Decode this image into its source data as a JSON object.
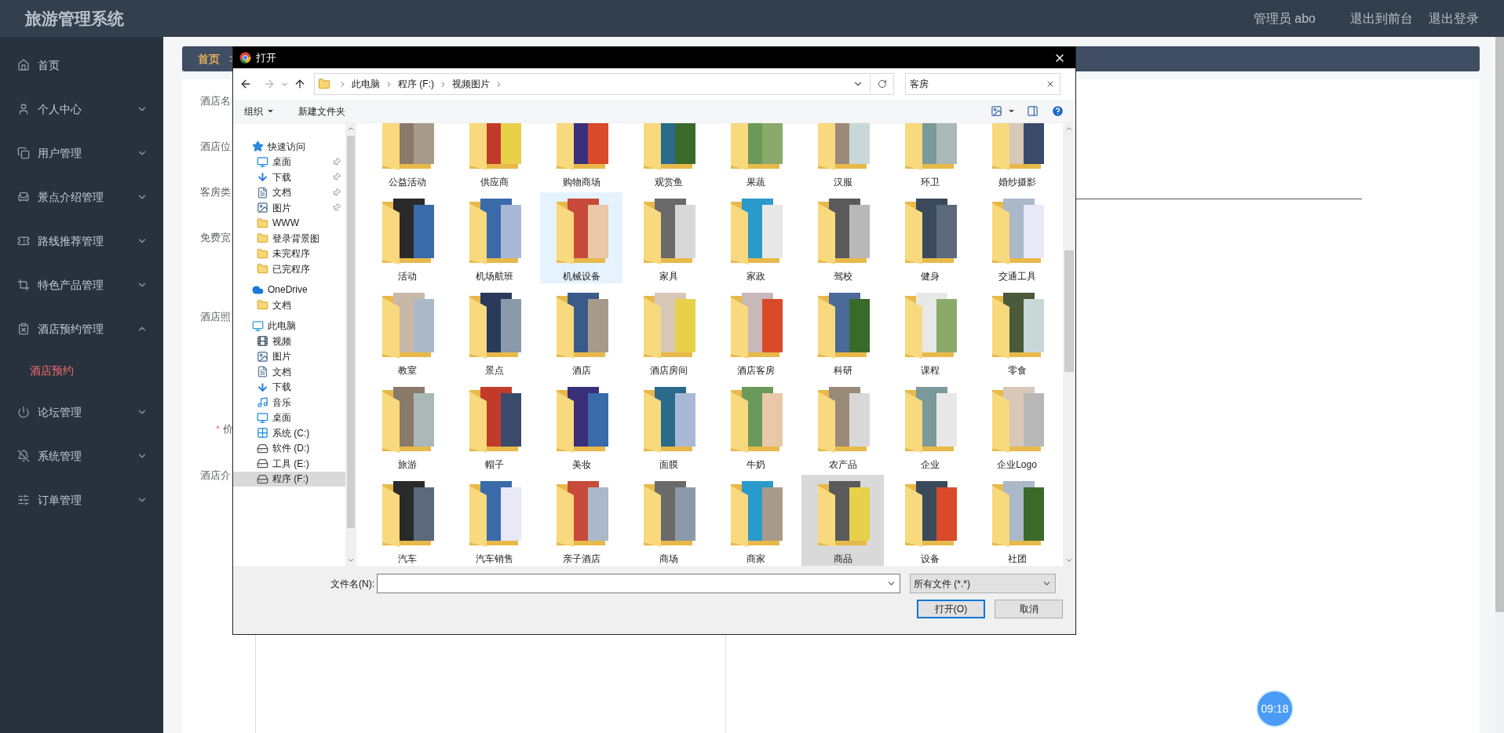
{
  "header": {
    "title": "旅游管理系统",
    "user": "管理员 abo",
    "links": [
      "退出到前台",
      "退出登录"
    ]
  },
  "sidebar": {
    "items": [
      {
        "label": "首页",
        "expandable": false
      },
      {
        "label": "个人中心",
        "expandable": true,
        "expanded": false
      },
      {
        "label": "用户管理",
        "expandable": true,
        "expanded": false
      },
      {
        "label": "景点介绍管理",
        "expandable": true,
        "expanded": false
      },
      {
        "label": "路线推荐管理",
        "expandable": true,
        "expanded": false
      },
      {
        "label": "特色产品管理",
        "expandable": true,
        "expanded": false
      },
      {
        "label": "酒店预约管理",
        "expandable": true,
        "expanded": true,
        "children": [
          {
            "label": "酒店预约",
            "selected": true
          }
        ]
      },
      {
        "label": "论坛管理",
        "expandable": true,
        "expanded": false
      },
      {
        "label": "系统管理",
        "expandable": true,
        "expanded": false
      },
      {
        "label": "订单管理",
        "expandable": true,
        "expanded": false
      }
    ]
  },
  "breadcrumb": {
    "items": [
      "首页"
    ],
    "separator": ">"
  },
  "form": {
    "required_mark": "*",
    "labels": [
      {
        "text": "酒店名",
        "required": false
      },
      {
        "text": "酒店位",
        "required": false
      },
      {
        "text": "客房类",
        "required": false
      },
      {
        "text": "免费宽",
        "required": false
      },
      {
        "text": "酒店照",
        "required": false
      },
      {
        "text": "价",
        "required": true
      },
      {
        "text": "酒店介",
        "required": false
      }
    ]
  },
  "file_dialog": {
    "title": "打开",
    "path": [
      "此电脑",
      "程序 (F:)",
      "视频图片"
    ],
    "search": {
      "value": "客房"
    },
    "toolbar": [
      "组织",
      "新建文件夹"
    ],
    "nav": [
      {
        "label": "快速访问",
        "kind": "quick-access",
        "selected": false,
        "children": [
          {
            "label": "桌面",
            "kind": "desktop",
            "pinned": true,
            "selected": false
          },
          {
            "label": "下载",
            "kind": "download",
            "pinned": true,
            "selected": false
          },
          {
            "label": "文档",
            "kind": "document",
            "pinned": true,
            "selected": false
          },
          {
            "label": "图片",
            "kind": "pictures",
            "pinned": true,
            "selected": false
          },
          {
            "label": "WWW",
            "kind": "folder",
            "pinned": false,
            "selected": false
          },
          {
            "label": "登录背景图",
            "kind": "folder",
            "pinned": false,
            "selected": false
          },
          {
            "label": "未完程序",
            "kind": "folder",
            "pinned": false,
            "selected": false
          },
          {
            "label": "已完程序",
            "kind": "folder",
            "pinned": false,
            "selected": false
          }
        ]
      },
      {
        "label": "OneDrive",
        "kind": "cloud",
        "selected": false,
        "children": [
          {
            "label": "文档",
            "kind": "folder",
            "pinned": false,
            "selected": false
          }
        ]
      },
      {
        "label": "此电脑",
        "kind": "computer",
        "selected": false,
        "children": [
          {
            "label": "视频",
            "kind": "video",
            "pinned": false,
            "selected": false
          },
          {
            "label": "图片",
            "kind": "pictures",
            "pinned": false,
            "selected": false
          },
          {
            "label": "文档",
            "kind": "document",
            "pinned": false,
            "selected": false
          },
          {
            "label": "下载",
            "kind": "download",
            "pinned": false,
            "selected": false
          },
          {
            "label": "音乐",
            "kind": "music",
            "pinned": false,
            "selected": false
          },
          {
            "label": "桌面",
            "kind": "desktop",
            "pinned": false,
            "selected": false
          },
          {
            "label": "系统 (C:)",
            "kind": "system-drive",
            "pinned": false,
            "selected": false
          },
          {
            "label": "软件 (D:)",
            "kind": "drive",
            "pinned": false,
            "selected": false
          },
          {
            "label": "工具 (E:)",
            "kind": "drive",
            "pinned": false,
            "selected": false
          },
          {
            "label": "程序 (F:)",
            "kind": "drive",
            "pinned": false,
            "selected": true
          }
        ]
      }
    ],
    "files": [
      {
        "name": "公益活动",
        "selected": false,
        "hovered": false
      },
      {
        "name": "供应商",
        "selected": false,
        "hovered": false
      },
      {
        "name": "购物商场",
        "selected": false,
        "hovered": false
      },
      {
        "name": "观赏鱼",
        "selected": false,
        "hovered": false
      },
      {
        "name": "果蔬",
        "selected": false,
        "hovered": false
      },
      {
        "name": "汉服",
        "selected": false,
        "hovered": false
      },
      {
        "name": "环卫",
        "selected": false,
        "hovered": false
      },
      {
        "name": "婚纱摄影",
        "selected": false,
        "hovered": false
      },
      {
        "name": "活动",
        "selected": false,
        "hovered": false
      },
      {
        "name": "机场航班",
        "selected": false,
        "hovered": false
      },
      {
        "name": "机械设备",
        "selected": false,
        "hovered": true
      },
      {
        "name": "家具",
        "selected": false,
        "hovered": false
      },
      {
        "name": "家政",
        "selected": false,
        "hovered": false
      },
      {
        "name": "驾校",
        "selected": false,
        "hovered": false
      },
      {
        "name": "健身",
        "selected": false,
        "hovered": false
      },
      {
        "name": "交通工具",
        "selected": false,
        "hovered": false
      },
      {
        "name": "教室",
        "selected": false,
        "hovered": false
      },
      {
        "name": "景点",
        "selected": false,
        "hovered": false
      },
      {
        "name": "酒店",
        "selected": false,
        "hovered": false
      },
      {
        "name": "酒店房间",
        "selected": false,
        "hovered": false
      },
      {
        "name": "酒店客房",
        "selected": false,
        "hovered": false
      },
      {
        "name": "科研",
        "selected": false,
        "hovered": false
      },
      {
        "name": "课程",
        "selected": false,
        "hovered": false
      },
      {
        "name": "零食",
        "selected": false,
        "hovered": false
      },
      {
        "name": "旅游",
        "selected": false,
        "hovered": false
      },
      {
        "name": "帽子",
        "selected": false,
        "hovered": false
      },
      {
        "name": "美妆",
        "selected": false,
        "hovered": false
      },
      {
        "name": "面膜",
        "selected": false,
        "hovered": false
      },
      {
        "name": "牛奶",
        "selected": false,
        "hovered": false
      },
      {
        "name": "农产品",
        "selected": false,
        "hovered": false
      },
      {
        "name": "企业",
        "selected": false,
        "hovered": false
      },
      {
        "name": "企业Logo",
        "selected": false,
        "hovered": false
      },
      {
        "name": "汽车",
        "selected": false,
        "hovered": false
      },
      {
        "name": "汽车销售",
        "selected": false,
        "hovered": false
      },
      {
        "name": "亲子酒店",
        "selected": false,
        "hovered": false
      },
      {
        "name": "商场",
        "selected": false,
        "hovered": false
      },
      {
        "name": "商家",
        "selected": false,
        "hovered": false
      },
      {
        "name": "商品",
        "selected": true,
        "hovered": false
      },
      {
        "name": "设备",
        "selected": false,
        "hovered": false
      },
      {
        "name": "社团",
        "selected": false,
        "hovered": false
      }
    ],
    "filename_label": "文件名(N):",
    "filetype": "所有文件 (*.*)",
    "buttons": [
      {
        "label": "打开(O)",
        "default": true
      },
      {
        "label": "取消",
        "default": false
      }
    ]
  },
  "clock": "09:18"
}
